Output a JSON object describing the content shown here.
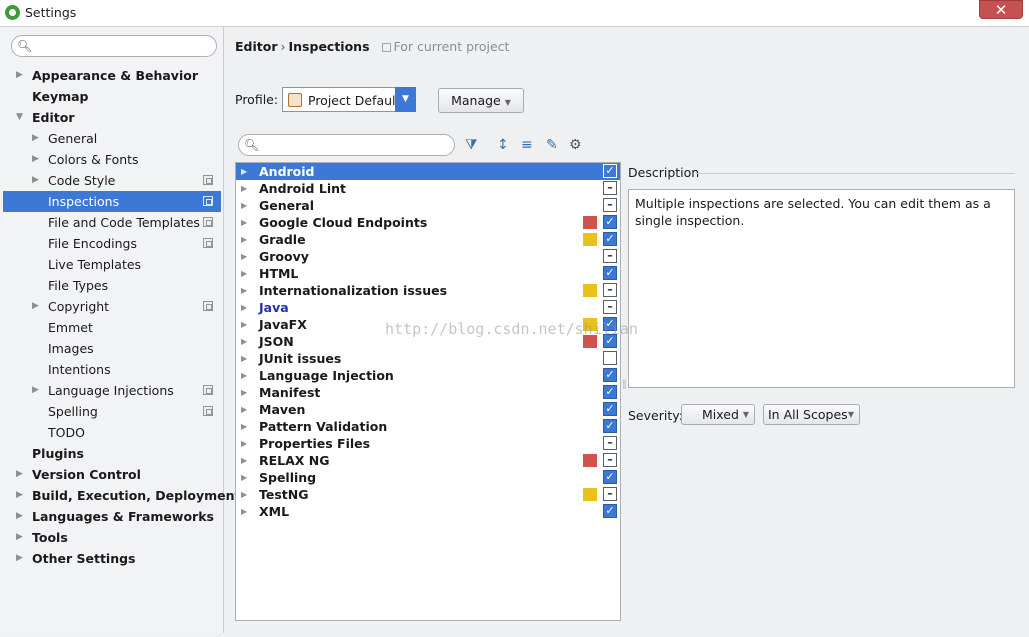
{
  "window": {
    "title": "Settings",
    "close_glyph": "✕"
  },
  "search": {
    "placeholder": ""
  },
  "tree": [
    {
      "label": "Appearance & Behavior",
      "level": 0,
      "bold": true,
      "arrow": "right"
    },
    {
      "label": "Keymap",
      "level": 0,
      "bold": true,
      "arrow": "none"
    },
    {
      "label": "Editor",
      "level": 0,
      "bold": true,
      "arrow": "down"
    },
    {
      "label": "General",
      "level": 1,
      "bold": false,
      "arrow": "right"
    },
    {
      "label": "Colors & Fonts",
      "level": 1,
      "bold": false,
      "arrow": "right"
    },
    {
      "label": "Code Style",
      "level": 1,
      "bold": false,
      "arrow": "right",
      "project": true
    },
    {
      "label": "Inspections",
      "level": 1,
      "bold": false,
      "arrow": "none",
      "project": true,
      "selected": true
    },
    {
      "label": "File and Code Templates",
      "level": 1,
      "bold": false,
      "arrow": "none",
      "project": true
    },
    {
      "label": "File Encodings",
      "level": 1,
      "bold": false,
      "arrow": "none",
      "project": true
    },
    {
      "label": "Live Templates",
      "level": 1,
      "bold": false,
      "arrow": "none"
    },
    {
      "label": "File Types",
      "level": 1,
      "bold": false,
      "arrow": "none"
    },
    {
      "label": "Copyright",
      "level": 1,
      "bold": false,
      "arrow": "right",
      "project": true
    },
    {
      "label": "Emmet",
      "level": 1,
      "bold": false,
      "arrow": "none"
    },
    {
      "label": "Images",
      "level": 1,
      "bold": false,
      "arrow": "none"
    },
    {
      "label": "Intentions",
      "level": 1,
      "bold": false,
      "arrow": "none"
    },
    {
      "label": "Language Injections",
      "level": 1,
      "bold": false,
      "arrow": "right",
      "project": true
    },
    {
      "label": "Spelling",
      "level": 1,
      "bold": false,
      "arrow": "none",
      "project": true
    },
    {
      "label": "TODO",
      "level": 1,
      "bold": false,
      "arrow": "none"
    },
    {
      "label": "Plugins",
      "level": 0,
      "bold": true,
      "arrow": "none"
    },
    {
      "label": "Version Control",
      "level": 0,
      "bold": true,
      "arrow": "right"
    },
    {
      "label": "Build, Execution, Deployment",
      "level": 0,
      "bold": true,
      "arrow": "right"
    },
    {
      "label": "Languages & Frameworks",
      "level": 0,
      "bold": true,
      "arrow": "right"
    },
    {
      "label": "Tools",
      "level": 0,
      "bold": true,
      "arrow": "right"
    },
    {
      "label": "Other Settings",
      "level": 0,
      "bold": true,
      "arrow": "right"
    }
  ],
  "breadcrumb": {
    "parent": "Editor",
    "separator": "›",
    "current": "Inspections",
    "scope": "For current project"
  },
  "profile": {
    "label": "Profile:",
    "value": "Project Default",
    "manage_label": "Manage"
  },
  "inspection_search": {
    "placeholder": ""
  },
  "inspections": [
    {
      "label": "Android",
      "selected": true,
      "check": "checked",
      "severity": ""
    },
    {
      "label": "Android Lint",
      "check": "partial",
      "severity": ""
    },
    {
      "label": "General",
      "check": "partial",
      "severity": ""
    },
    {
      "label": "Google Cloud Endpoints",
      "check": "checked",
      "severity": "#d0534f"
    },
    {
      "label": "Gradle",
      "check": "checked",
      "severity": "#e8c11a"
    },
    {
      "label": "Groovy",
      "check": "partial",
      "severity": ""
    },
    {
      "label": "HTML",
      "check": "checked",
      "severity": ""
    },
    {
      "label": "Internationalization issues",
      "check": "partial",
      "severity": "#e8c11a"
    },
    {
      "label": "Java",
      "check": "partial",
      "severity": "",
      "java": true
    },
    {
      "label": "JavaFX",
      "check": "checked",
      "severity": "#e8c11a"
    },
    {
      "label": "JSON",
      "check": "checked",
      "severity": "#d0534f"
    },
    {
      "label": "JUnit issues",
      "check": "unchecked",
      "severity": ""
    },
    {
      "label": "Language Injection",
      "check": "checked",
      "severity": ""
    },
    {
      "label": "Manifest",
      "check": "checked",
      "severity": ""
    },
    {
      "label": "Maven",
      "check": "checked",
      "severity": ""
    },
    {
      "label": "Pattern Validation",
      "check": "checked",
      "severity": ""
    },
    {
      "label": "Properties Files",
      "check": "partial",
      "severity": ""
    },
    {
      "label": "RELAX NG",
      "check": "partial",
      "severity": "#d0534f"
    },
    {
      "label": "Spelling",
      "check": "checked",
      "severity": ""
    },
    {
      "label": "TestNG",
      "check": "partial",
      "severity": "#e8c11a"
    },
    {
      "label": "XML",
      "check": "checked",
      "severity": ""
    }
  ],
  "description": {
    "title": "Description",
    "text": "Multiple inspections are selected. You can edit them as a single inspection."
  },
  "severity": {
    "label": "Severity:",
    "value": "Mixed",
    "scope_value": "In All Scopes"
  },
  "watermark": "http://blog.csdn.net/shilian",
  "colors": {
    "accent": "#3d78d6",
    "error": "#d0534f",
    "warning": "#e8c11a",
    "close": "#c75050"
  }
}
